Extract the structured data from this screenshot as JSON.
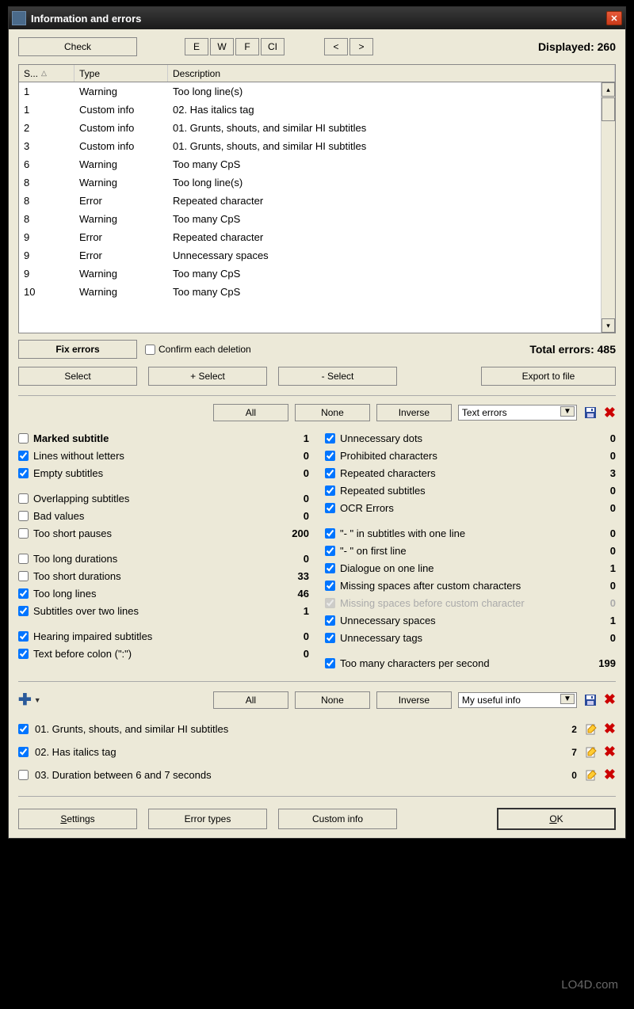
{
  "title": "Information and errors",
  "toolbar": {
    "check": "Check",
    "filter_e": "E",
    "filter_w": "W",
    "filter_f": "F",
    "filter_ci": "CI",
    "prev": "<",
    "next": ">",
    "displayed_label": "Displayed: 260"
  },
  "table": {
    "headers": {
      "s": "S...",
      "type": "Type",
      "desc": "Description"
    },
    "rows": [
      {
        "s": "1",
        "type": "Warning",
        "desc": "Too long line(s)"
      },
      {
        "s": "1",
        "type": "Custom info",
        "desc": "02. Has italics tag"
      },
      {
        "s": "2",
        "type": "Custom info",
        "desc": "01. Grunts, shouts, and similar HI subtitles"
      },
      {
        "s": "3",
        "type": "Custom info",
        "desc": "01. Grunts, shouts, and similar HI subtitles"
      },
      {
        "s": "6",
        "type": "Warning",
        "desc": "Too many CpS"
      },
      {
        "s": "8",
        "type": "Warning",
        "desc": "Too long line(s)"
      },
      {
        "s": "8",
        "type": "Error",
        "desc": "Repeated character"
      },
      {
        "s": "8",
        "type": "Warning",
        "desc": "Too many CpS"
      },
      {
        "s": "9",
        "type": "Error",
        "desc": "Repeated character"
      },
      {
        "s": "9",
        "type": "Error",
        "desc": "Unnecessary spaces"
      },
      {
        "s": "9",
        "type": "Warning",
        "desc": "Too many CpS"
      },
      {
        "s": "10",
        "type": "Warning",
        "desc": "Too many CpS"
      }
    ]
  },
  "actions": {
    "fix_errors": "Fix errors",
    "confirm_each": "Confirm each deletion",
    "total_errors": "Total errors: 485",
    "select": "Select",
    "plus_select": "+ Select",
    "minus_select": "- Select",
    "export": "Export to file"
  },
  "filter1": {
    "all": "All",
    "none": "None",
    "inverse": "Inverse",
    "combo": "Text errors"
  },
  "checks_left": [
    {
      "label": "Marked subtitle",
      "count": "1",
      "checked": false,
      "bold": true
    },
    {
      "label": "Lines without letters",
      "count": "0",
      "checked": true
    },
    {
      "label": "Empty subtitles",
      "count": "0",
      "checked": true
    },
    {
      "gap": true
    },
    {
      "label": "Overlapping subtitles",
      "count": "0",
      "checked": false
    },
    {
      "label": "Bad values",
      "count": "0",
      "checked": false
    },
    {
      "label": "Too short pauses",
      "count": "200",
      "checked": false
    },
    {
      "gap": true
    },
    {
      "label": "Too long durations",
      "count": "0",
      "checked": false
    },
    {
      "label": "Too short durations",
      "count": "33",
      "checked": false
    },
    {
      "label": "Too long lines",
      "count": "46",
      "checked": true
    },
    {
      "label": "Subtitles over two lines",
      "count": "1",
      "checked": true
    },
    {
      "gap": true
    },
    {
      "label": "Hearing impaired subtitles",
      "count": "0",
      "checked": true
    },
    {
      "label": "Text before colon (\":\")",
      "count": "0",
      "checked": true
    }
  ],
  "checks_right": [
    {
      "label": "Unnecessary dots",
      "count": "0",
      "checked": true
    },
    {
      "label": "Prohibited characters",
      "count": "0",
      "checked": true
    },
    {
      "label": "Repeated characters",
      "count": "3",
      "checked": true
    },
    {
      "label": "Repeated subtitles",
      "count": "0",
      "checked": true
    },
    {
      "label": "OCR Errors",
      "count": "0",
      "checked": true
    },
    {
      "gap": true
    },
    {
      "label": "\"- \" in subtitles with one line",
      "count": "0",
      "checked": true
    },
    {
      "label": "\"- \" on first line",
      "count": "0",
      "checked": true
    },
    {
      "label": "Dialogue on one line",
      "count": "1",
      "checked": true
    },
    {
      "label": "Missing spaces after custom characters",
      "count": "0",
      "checked": true
    },
    {
      "label": "Missing spaces before custom character",
      "count": "0",
      "checked": true,
      "disabled": true
    },
    {
      "label": "Unnecessary spaces",
      "count": "1",
      "checked": true
    },
    {
      "label": "Unnecessary tags",
      "count": "0",
      "checked": true
    },
    {
      "gap": true
    },
    {
      "label": "Too many characters per second",
      "count": "199",
      "checked": true
    }
  ],
  "filter2": {
    "all": "All",
    "none": "None",
    "inverse": "Inverse",
    "combo": "My useful info"
  },
  "custom": [
    {
      "label": "01. Grunts, shouts, and similar HI subtitles",
      "count": "2",
      "checked": true
    },
    {
      "label": "02. Has italics tag",
      "count": "7",
      "checked": true
    },
    {
      "label": "03. Duration between 6 and 7 seconds",
      "count": "0",
      "checked": false
    }
  ],
  "bottom": {
    "settings": "Settings",
    "error_types": "Error types",
    "custom_info": "Custom info",
    "ok": "OK"
  },
  "watermark": "LO4D.com"
}
